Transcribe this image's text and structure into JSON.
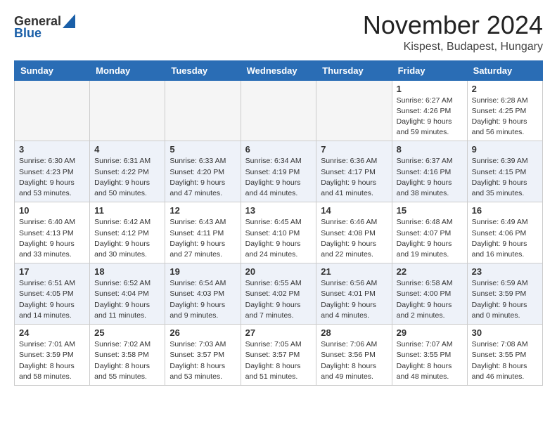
{
  "header": {
    "logo_line1": "General",
    "logo_line2": "Blue",
    "month": "November 2024",
    "location": "Kispest, Budapest, Hungary"
  },
  "days_of_week": [
    "Sunday",
    "Monday",
    "Tuesday",
    "Wednesday",
    "Thursday",
    "Friday",
    "Saturday"
  ],
  "weeks": [
    [
      {
        "day": "",
        "info": ""
      },
      {
        "day": "",
        "info": ""
      },
      {
        "day": "",
        "info": ""
      },
      {
        "day": "",
        "info": ""
      },
      {
        "day": "",
        "info": ""
      },
      {
        "day": "1",
        "info": "Sunrise: 6:27 AM\nSunset: 4:26 PM\nDaylight: 9 hours\nand 59 minutes."
      },
      {
        "day": "2",
        "info": "Sunrise: 6:28 AM\nSunset: 4:25 PM\nDaylight: 9 hours\nand 56 minutes."
      }
    ],
    [
      {
        "day": "3",
        "info": "Sunrise: 6:30 AM\nSunset: 4:23 PM\nDaylight: 9 hours\nand 53 minutes."
      },
      {
        "day": "4",
        "info": "Sunrise: 6:31 AM\nSunset: 4:22 PM\nDaylight: 9 hours\nand 50 minutes."
      },
      {
        "day": "5",
        "info": "Sunrise: 6:33 AM\nSunset: 4:20 PM\nDaylight: 9 hours\nand 47 minutes."
      },
      {
        "day": "6",
        "info": "Sunrise: 6:34 AM\nSunset: 4:19 PM\nDaylight: 9 hours\nand 44 minutes."
      },
      {
        "day": "7",
        "info": "Sunrise: 6:36 AM\nSunset: 4:17 PM\nDaylight: 9 hours\nand 41 minutes."
      },
      {
        "day": "8",
        "info": "Sunrise: 6:37 AM\nSunset: 4:16 PM\nDaylight: 9 hours\nand 38 minutes."
      },
      {
        "day": "9",
        "info": "Sunrise: 6:39 AM\nSunset: 4:15 PM\nDaylight: 9 hours\nand 35 minutes."
      }
    ],
    [
      {
        "day": "10",
        "info": "Sunrise: 6:40 AM\nSunset: 4:13 PM\nDaylight: 9 hours\nand 33 minutes."
      },
      {
        "day": "11",
        "info": "Sunrise: 6:42 AM\nSunset: 4:12 PM\nDaylight: 9 hours\nand 30 minutes."
      },
      {
        "day": "12",
        "info": "Sunrise: 6:43 AM\nSunset: 4:11 PM\nDaylight: 9 hours\nand 27 minutes."
      },
      {
        "day": "13",
        "info": "Sunrise: 6:45 AM\nSunset: 4:10 PM\nDaylight: 9 hours\nand 24 minutes."
      },
      {
        "day": "14",
        "info": "Sunrise: 6:46 AM\nSunset: 4:08 PM\nDaylight: 9 hours\nand 22 minutes."
      },
      {
        "day": "15",
        "info": "Sunrise: 6:48 AM\nSunset: 4:07 PM\nDaylight: 9 hours\nand 19 minutes."
      },
      {
        "day": "16",
        "info": "Sunrise: 6:49 AM\nSunset: 4:06 PM\nDaylight: 9 hours\nand 16 minutes."
      }
    ],
    [
      {
        "day": "17",
        "info": "Sunrise: 6:51 AM\nSunset: 4:05 PM\nDaylight: 9 hours\nand 14 minutes."
      },
      {
        "day": "18",
        "info": "Sunrise: 6:52 AM\nSunset: 4:04 PM\nDaylight: 9 hours\nand 11 minutes."
      },
      {
        "day": "19",
        "info": "Sunrise: 6:54 AM\nSunset: 4:03 PM\nDaylight: 9 hours\nand 9 minutes."
      },
      {
        "day": "20",
        "info": "Sunrise: 6:55 AM\nSunset: 4:02 PM\nDaylight: 9 hours\nand 7 minutes."
      },
      {
        "day": "21",
        "info": "Sunrise: 6:56 AM\nSunset: 4:01 PM\nDaylight: 9 hours\nand 4 minutes."
      },
      {
        "day": "22",
        "info": "Sunrise: 6:58 AM\nSunset: 4:00 PM\nDaylight: 9 hours\nand 2 minutes."
      },
      {
        "day": "23",
        "info": "Sunrise: 6:59 AM\nSunset: 3:59 PM\nDaylight: 9 hours\nand 0 minutes."
      }
    ],
    [
      {
        "day": "24",
        "info": "Sunrise: 7:01 AM\nSunset: 3:59 PM\nDaylight: 8 hours\nand 58 minutes."
      },
      {
        "day": "25",
        "info": "Sunrise: 7:02 AM\nSunset: 3:58 PM\nDaylight: 8 hours\nand 55 minutes."
      },
      {
        "day": "26",
        "info": "Sunrise: 7:03 AM\nSunset: 3:57 PM\nDaylight: 8 hours\nand 53 minutes."
      },
      {
        "day": "27",
        "info": "Sunrise: 7:05 AM\nSunset: 3:57 PM\nDaylight: 8 hours\nand 51 minutes."
      },
      {
        "day": "28",
        "info": "Sunrise: 7:06 AM\nSunset: 3:56 PM\nDaylight: 8 hours\nand 49 minutes."
      },
      {
        "day": "29",
        "info": "Sunrise: 7:07 AM\nSunset: 3:55 PM\nDaylight: 8 hours\nand 48 minutes."
      },
      {
        "day": "30",
        "info": "Sunrise: 7:08 AM\nSunset: 3:55 PM\nDaylight: 8 hours\nand 46 minutes."
      }
    ]
  ]
}
